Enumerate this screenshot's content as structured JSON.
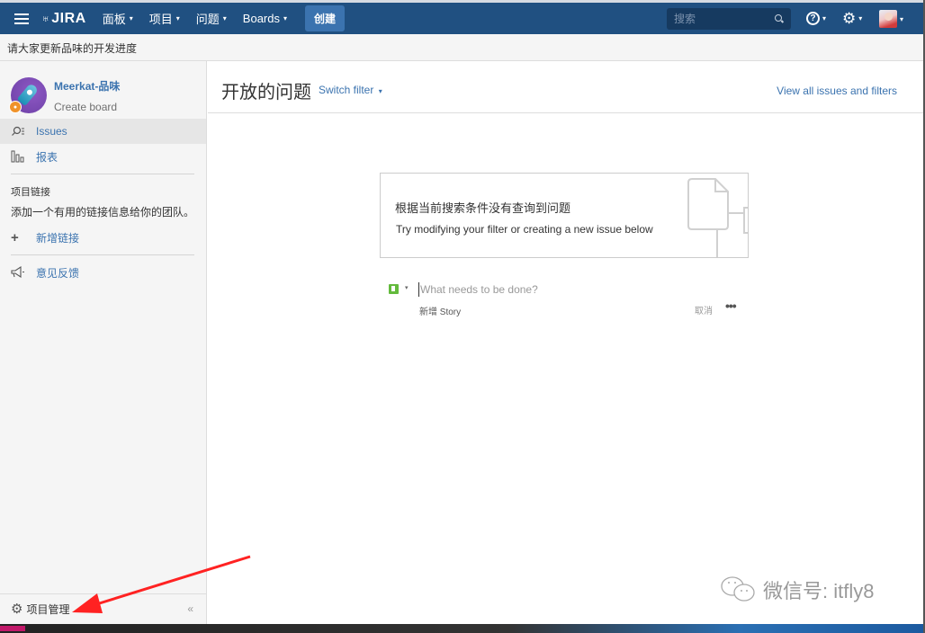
{
  "topnav": {
    "logo": "JIRA",
    "items": [
      {
        "label": "面板"
      },
      {
        "label": "项目"
      },
      {
        "label": "问题"
      },
      {
        "label": "Boards"
      }
    ],
    "create_label": "创建",
    "search_placeholder": "搜索",
    "help_glyph": "?",
    "gear_glyph": "⚙",
    "caret": "▾",
    "colors": {
      "bar": "#205081",
      "create": "#3b73af"
    }
  },
  "banner": {
    "text": "请大家更新品味的开发进度"
  },
  "sidebar": {
    "project_name": "Meerkat-品味",
    "project_sub": "Create board",
    "items": [
      {
        "label": "Issues",
        "icon": "issues-search-icon",
        "active": true
      },
      {
        "label": "报表",
        "icon": "reports-bar-icon",
        "active": false
      }
    ],
    "links_section": {
      "title": "项目链接",
      "description": "添加一个有用的链接信息给你的团队。",
      "add_label": "新增链接",
      "add_glyph": "+"
    },
    "feedback_label": "意见反馈",
    "footer": {
      "label": "项目管理",
      "gear_glyph": "⚙",
      "collapse_glyph": "«"
    }
  },
  "main": {
    "title": "开放的问题",
    "switch_filter": "Switch filter",
    "view_all": "View all issues and filters",
    "empty_state": {
      "title": "根据当前搜索条件没有查询到问题",
      "subtitle": "Try modifying your filter or creating a new issue below"
    },
    "inline_create": {
      "placeholder": "What needs to be done?",
      "type_label": "新增 Story",
      "cancel_label": "取消",
      "more_glyph": "•••",
      "type_caret": "▾"
    }
  },
  "watermark": {
    "text": "微信号: itfly8"
  }
}
